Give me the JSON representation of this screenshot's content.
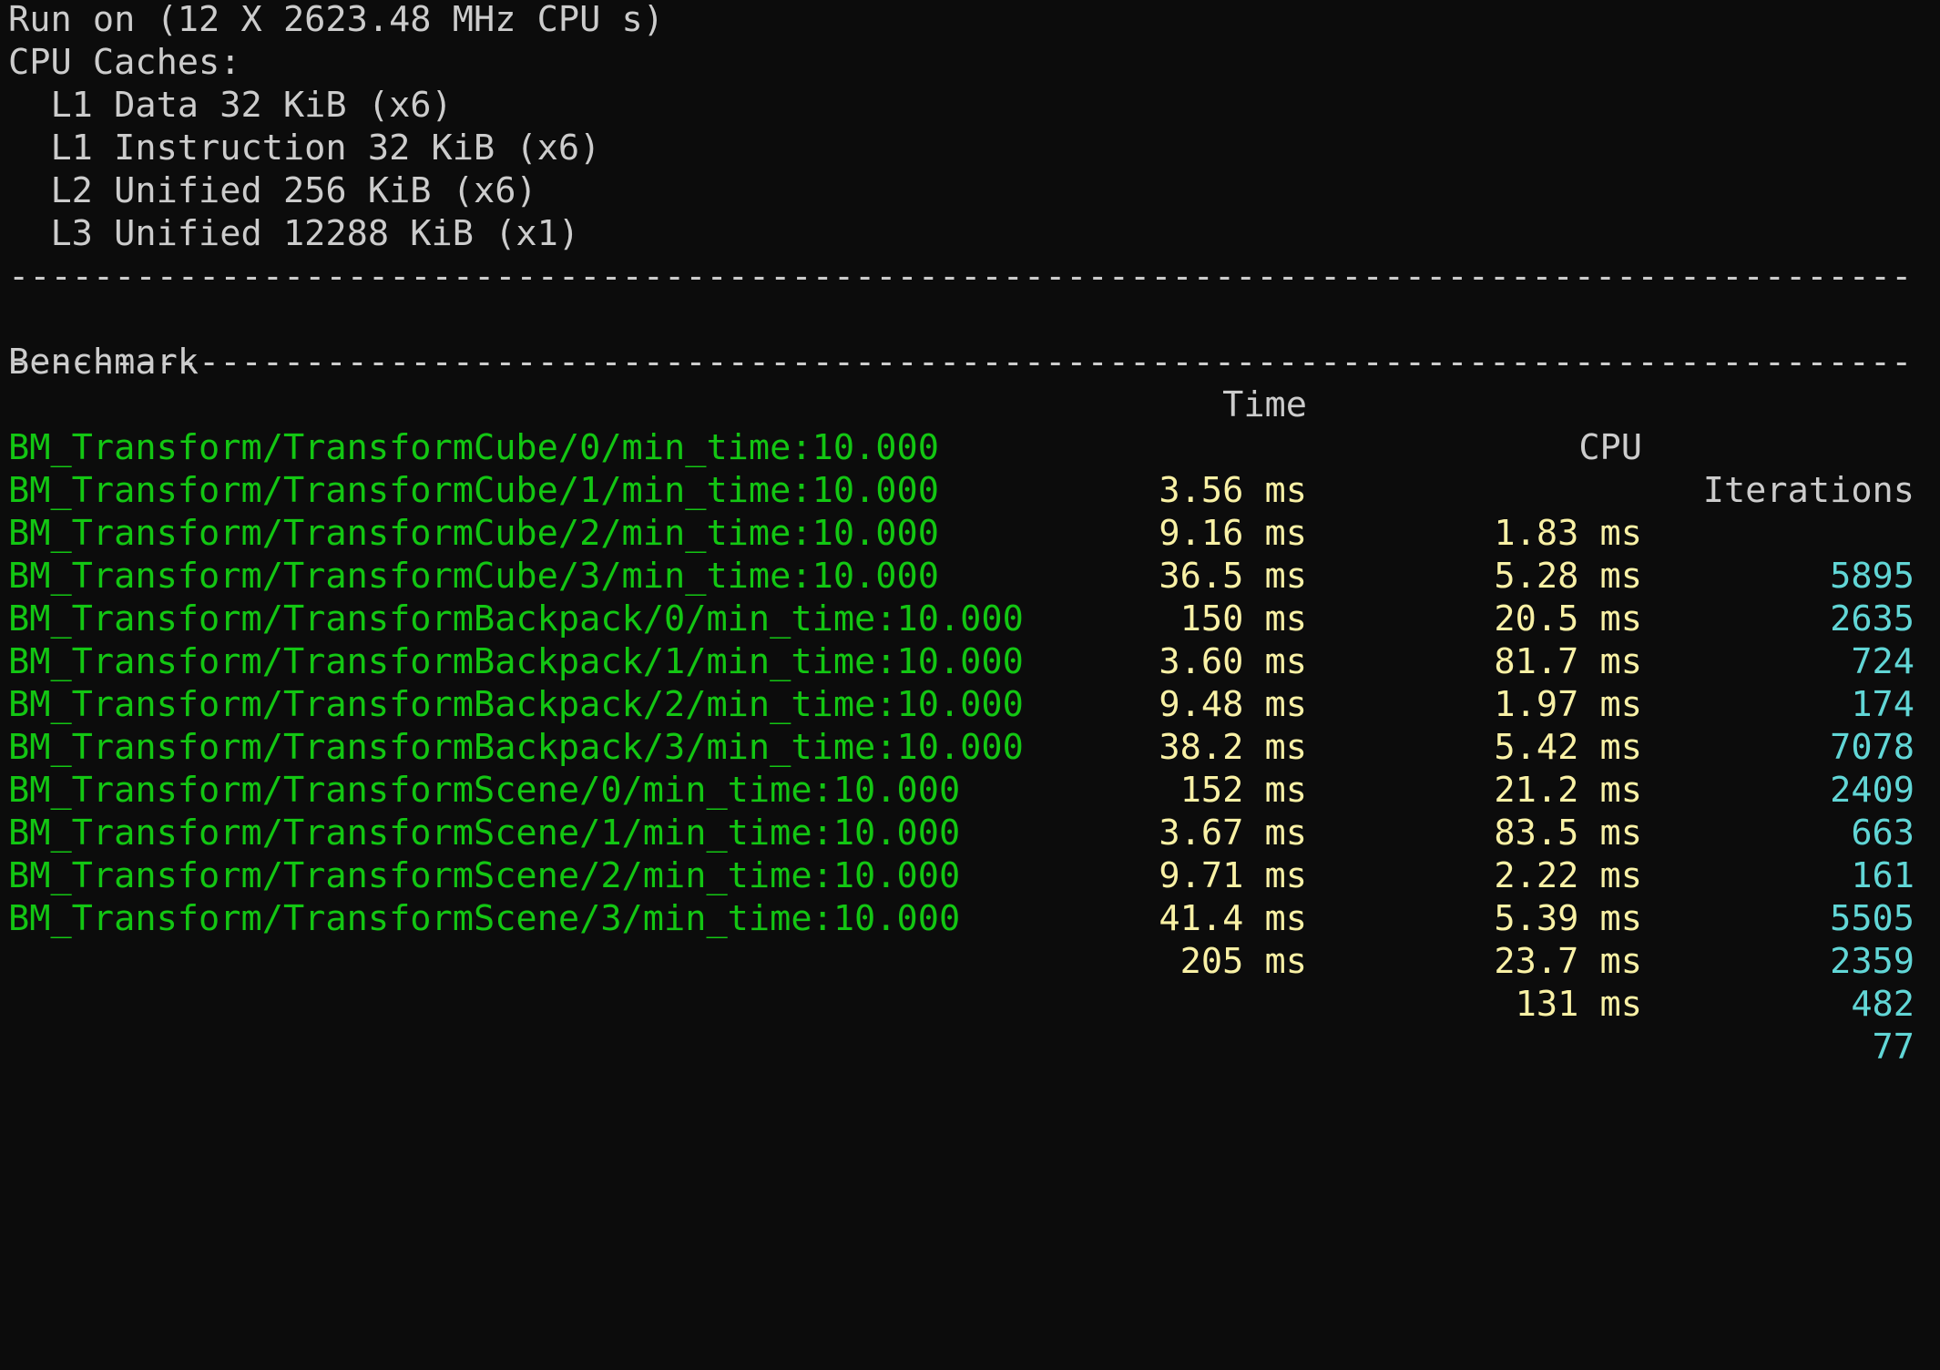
{
  "context": {
    "run_on": "Run on (12 X 2623.48 MHz CPU s)",
    "caches_title": "CPU Caches:",
    "caches": [
      "  L1 Data 32 KiB (x6)",
      "  L1 Instruction 32 KiB (x6)",
      "  L2 Unified 256 KiB (x6)",
      "  L3 Unified 12288 KiB (x1)"
    ]
  },
  "separator": "------------------------------------------------------------------------------------------------------------------------",
  "table": {
    "headers": {
      "benchmark": "Benchmark",
      "time": "Time",
      "cpu": "CPU",
      "iterations": "Iterations"
    },
    "rows": [
      {
        "name": "BM_Transform/TransformCube/0/min_time:10.000",
        "time": "3.56 ms",
        "cpu": "1.83 ms",
        "iterations": "5895"
      },
      {
        "name": "BM_Transform/TransformCube/1/min_time:10.000",
        "time": "9.16 ms",
        "cpu": "5.28 ms",
        "iterations": "2635"
      },
      {
        "name": "BM_Transform/TransformCube/2/min_time:10.000",
        "time": "36.5 ms",
        "cpu": "20.5 ms",
        "iterations": "724"
      },
      {
        "name": "BM_Transform/TransformCube/3/min_time:10.000",
        "time": "150 ms",
        "cpu": "81.7 ms",
        "iterations": "174"
      },
      {
        "name": "BM_Transform/TransformBackpack/0/min_time:10.000",
        "time": "3.60 ms",
        "cpu": "1.97 ms",
        "iterations": "7078"
      },
      {
        "name": "BM_Transform/TransformBackpack/1/min_time:10.000",
        "time": "9.48 ms",
        "cpu": "5.42 ms",
        "iterations": "2409"
      },
      {
        "name": "BM_Transform/TransformBackpack/2/min_time:10.000",
        "time": "38.2 ms",
        "cpu": "21.2 ms",
        "iterations": "663"
      },
      {
        "name": "BM_Transform/TransformBackpack/3/min_time:10.000",
        "time": "152 ms",
        "cpu": "83.5 ms",
        "iterations": "161"
      },
      {
        "name": "BM_Transform/TransformScene/0/min_time:10.000",
        "time": "3.67 ms",
        "cpu": "2.22 ms",
        "iterations": "5505"
      },
      {
        "name": "BM_Transform/TransformScene/1/min_time:10.000",
        "time": "9.71 ms",
        "cpu": "5.39 ms",
        "iterations": "2359"
      },
      {
        "name": "BM_Transform/TransformScene/2/min_time:10.000",
        "time": "41.4 ms",
        "cpu": "23.7 ms",
        "iterations": "482"
      },
      {
        "name": "BM_Transform/TransformScene/3/min_time:10.000",
        "time": "205 ms",
        "cpu": "131 ms",
        "iterations": "77"
      }
    ]
  },
  "colors": {
    "background": "#0c0c0c",
    "default_text": "#cccccc",
    "benchmark_name": "#13c613",
    "timing": "#f9f1a5",
    "iterations": "#61d6d6"
  }
}
